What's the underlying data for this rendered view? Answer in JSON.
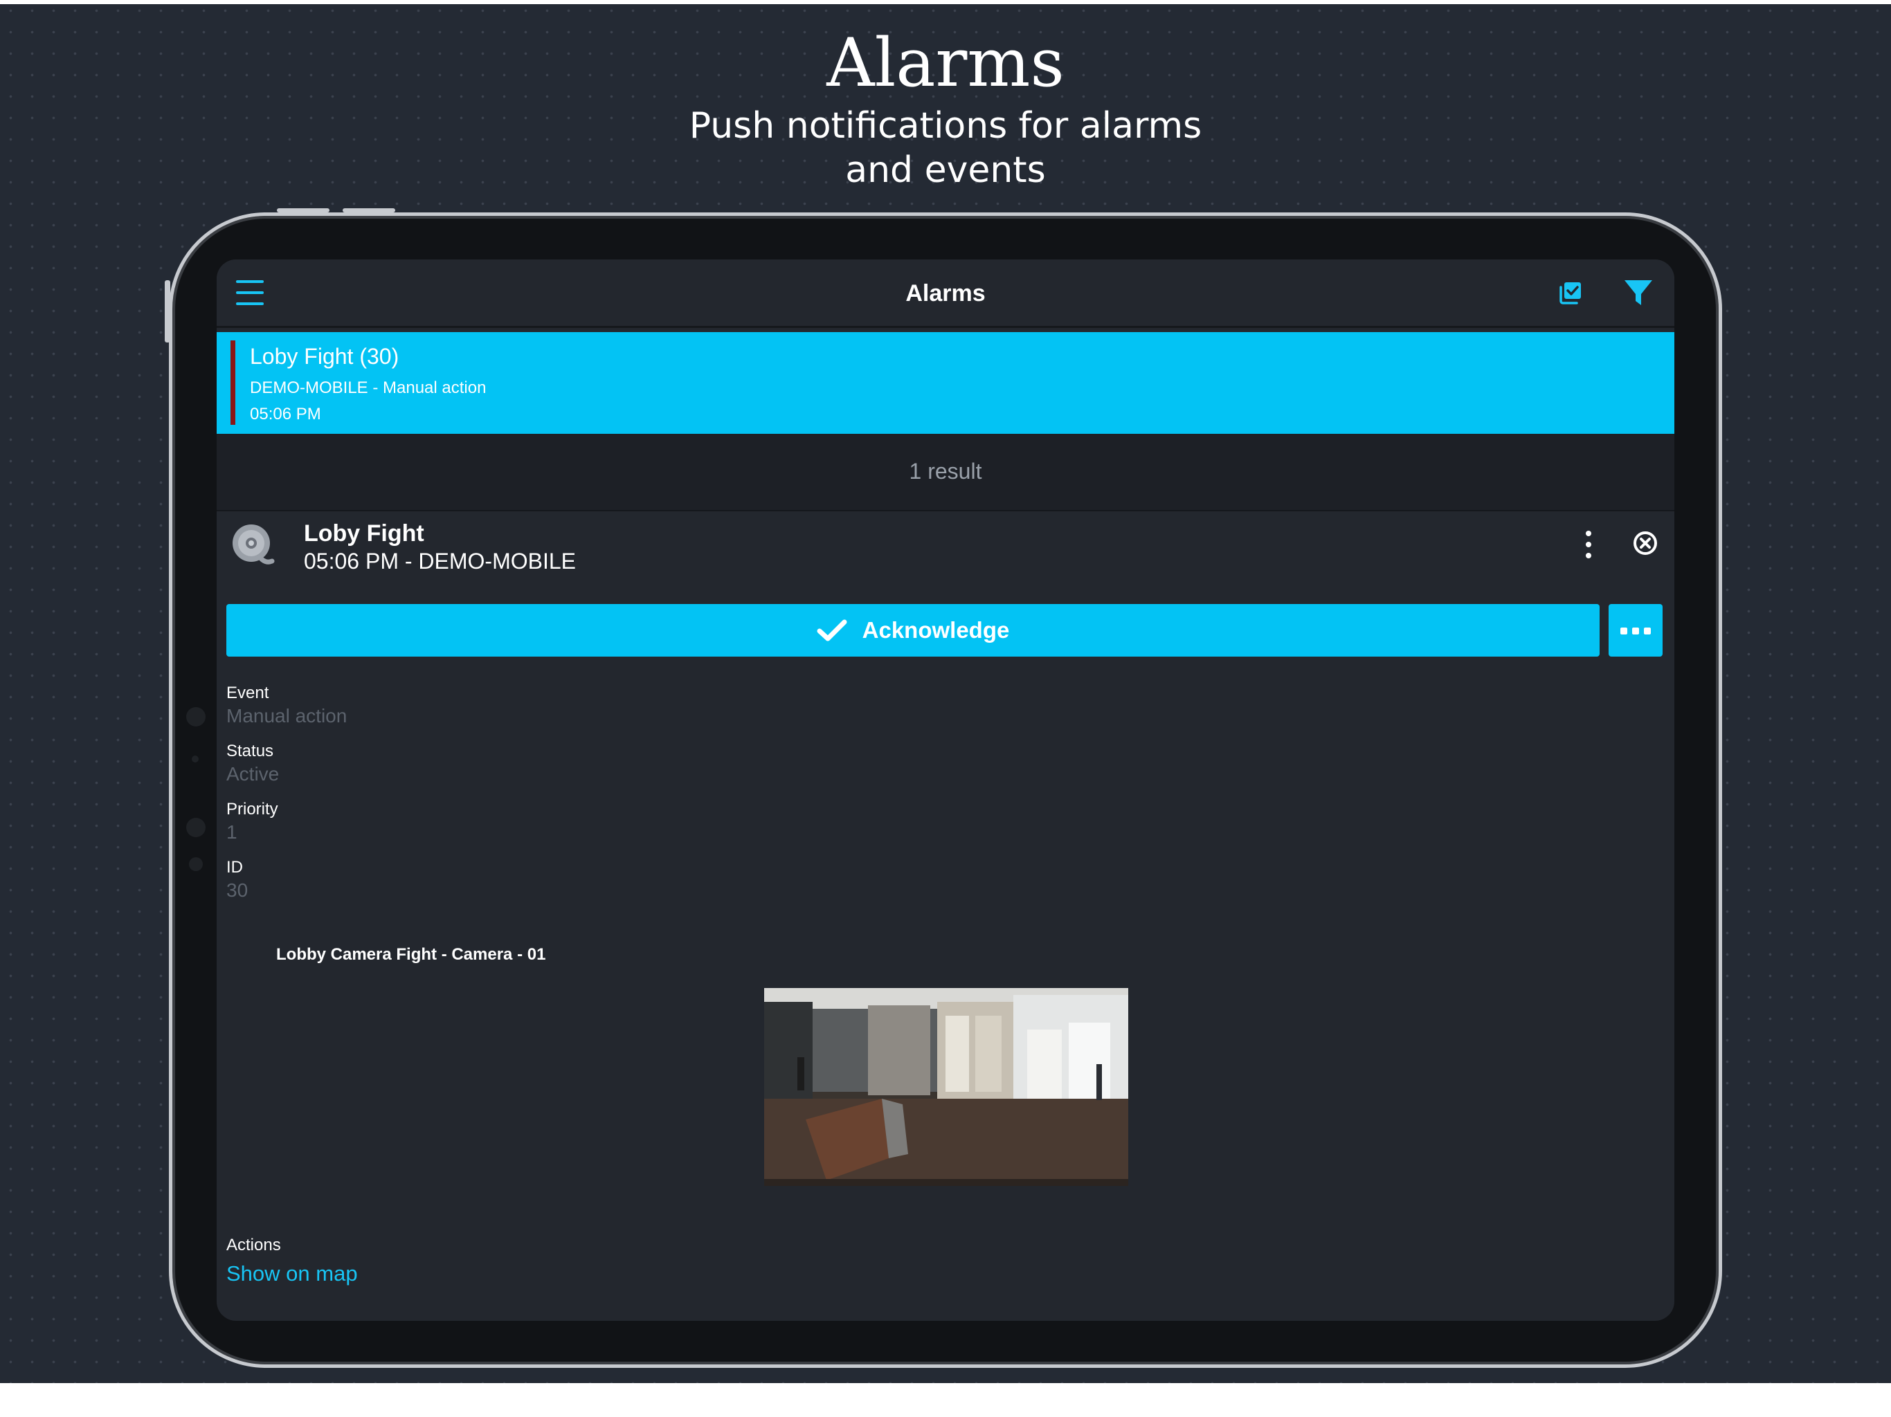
{
  "promo": {
    "headline": "Alarms",
    "subline_1": "Push notifications for alarms",
    "subline_2": "and events"
  },
  "topbar": {
    "title": "Alarms",
    "menu_icon": "hamburger-menu-icon",
    "select_icon": "checkbox-select-icon",
    "filter_icon": "filter-funnel-icon"
  },
  "alarm_list": {
    "items": [
      {
        "title": "Loby Fight (30)",
        "subtitle": "DEMO-MOBILE - Manual action",
        "time": "05:06 PM",
        "priority_color": "#8b1616"
      }
    ],
    "result_count": "1 result"
  },
  "detail": {
    "icon": "alarm-bell-icon",
    "title": "Loby Fight",
    "subtitle": "05:06 PM - DEMO-MOBILE",
    "acknowledge_label": "Acknowledge",
    "properties": [
      {
        "label": "Event",
        "value": "Manual action"
      },
      {
        "label": "Status",
        "value": "Active"
      },
      {
        "label": "Priority",
        "value": "1"
      },
      {
        "label": "ID",
        "value": "30"
      }
    ],
    "camera_title": "Lobby Camera Fight - Camera - 01",
    "actions_label": "Actions",
    "show_on_map": "Show on map"
  },
  "colors": {
    "accent": "#03c3f4",
    "background": "#23272e",
    "priority_bar": "#8b1616"
  }
}
